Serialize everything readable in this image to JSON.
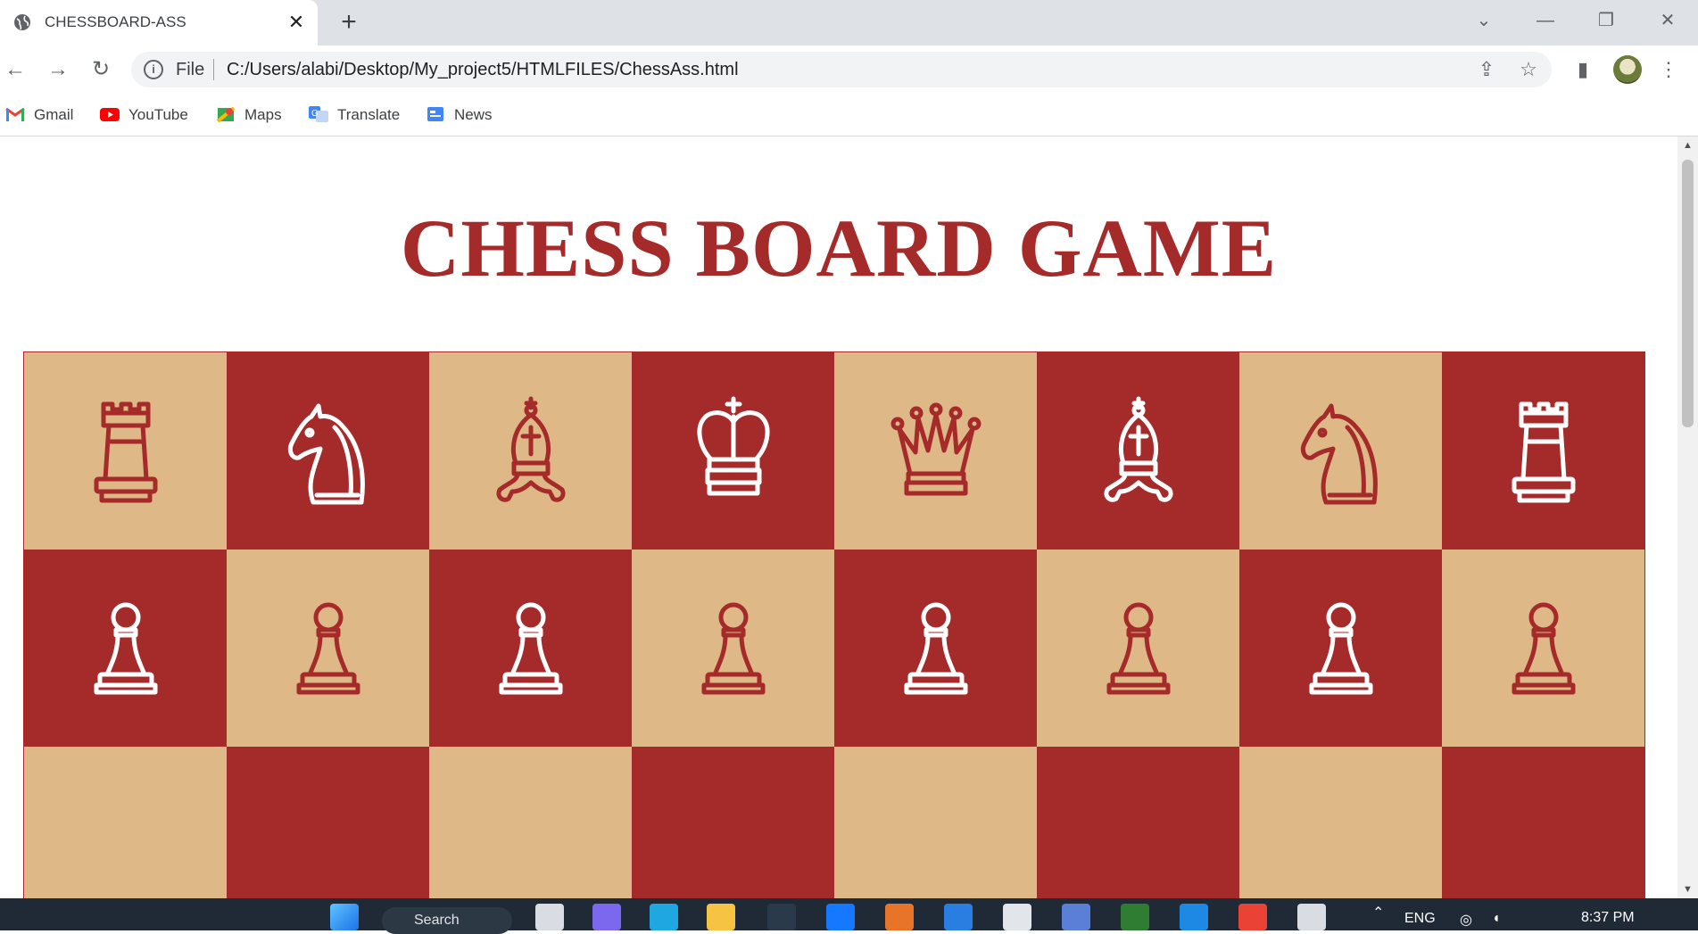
{
  "browser": {
    "tab_title": "CHESSBOARD-ASS",
    "tab_close": "✕",
    "new_tab": "+",
    "omnibox_scheme": "File",
    "url": "C:/Users/alabi/Desktop/My_project5/HTMLFILES/ChessAss.html",
    "bookmarks": [
      "Gmail",
      "YouTube",
      "Maps",
      "Translate",
      "News"
    ]
  },
  "page": {
    "heading": "CHESS BOARD GAME"
  },
  "board": {
    "light_color": "#deb887",
    "dark_color": "#a52a2a",
    "rows": [
      [
        "rook",
        "knight",
        "bishop",
        "king",
        "queen",
        "bishop",
        "knight",
        "rook"
      ],
      [
        "pawn",
        "pawn",
        "pawn",
        "pawn",
        "pawn",
        "pawn",
        "pawn",
        "pawn"
      ],
      [
        "",
        "",
        "",
        "",
        "",
        "",
        "",
        ""
      ]
    ]
  },
  "taskbar": {
    "search_label": "Search",
    "language": "ENG",
    "time": "8:37 PM"
  }
}
